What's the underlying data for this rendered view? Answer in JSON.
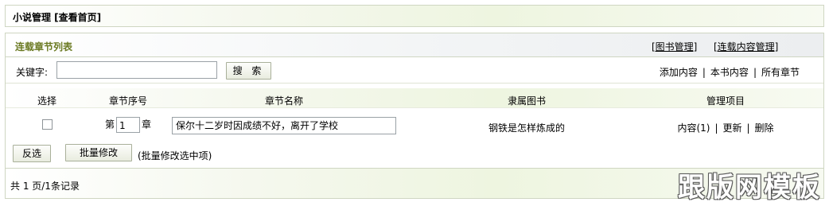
{
  "top_bar": {
    "title": "小说管理 [查看首页]"
  },
  "panel": {
    "title": "连载章节列表",
    "header_links": [
      "[图书管理]",
      "[连载内容管理]"
    ]
  },
  "search": {
    "label": "关键字:",
    "value": "",
    "button": "搜 索",
    "links": [
      "添加内容",
      "本书内容",
      "所有章节"
    ]
  },
  "table": {
    "headers": [
      "选择",
      "章节序号",
      "章节名称",
      "隶属图书",
      "管理项目"
    ],
    "rows": [
      {
        "checked": false,
        "prefix": "第",
        "number": "1",
        "suffix": "章",
        "name": "保尔十二岁时因成绩不好，离开了学校",
        "book": "钢铁是怎样炼成的",
        "actions": [
          "内容(1)",
          "更新",
          "删除"
        ]
      }
    ]
  },
  "actions": {
    "invert_button": "反选",
    "batch_button": "批量修改",
    "note": "(批量修改选中项)"
  },
  "footer": {
    "text": "共 1 页/1条记录"
  },
  "watermark": "跟版网模板"
}
